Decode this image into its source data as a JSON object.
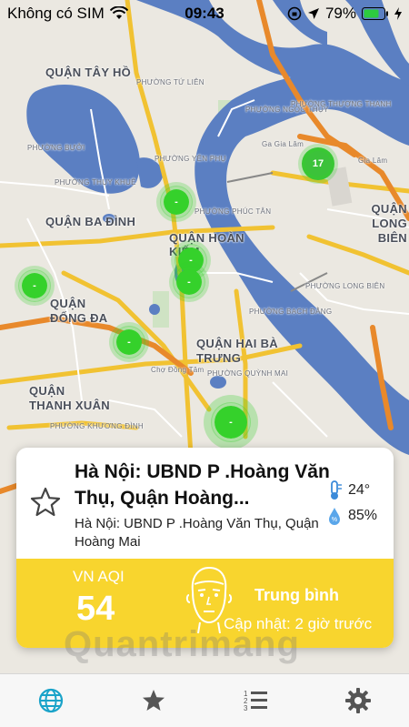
{
  "status_bar": {
    "carrier": "Không có SIM",
    "time": "09:43",
    "battery": "79%"
  },
  "map": {
    "labels": [
      "QUẬN TÂY HỒ",
      "QUẬN BA ĐÌNH",
      "QUẬN HOÀN KIẾM",
      "QUẬN ĐỐNG ĐA",
      "QUẬN HAI BÀ TRƯNG",
      "QUẬN THANH XUÂN",
      "QUẬN LONG BIÊN",
      "PHƯỜNG NGỌC THỤY",
      "PHƯỜNG THƯỢNG THANH",
      "PHƯỜNG TỨ LIÊN",
      "PHƯỜNG YÊN PHỤ",
      "PHƯỜNG BƯỞI",
      "PHƯỜNG THỤY KHUÊ",
      "PHƯỜNG PHÚC TÂN",
      "PHƯỜNG BẠCH ĐẰNG",
      "PHƯỜNG LONG BIÊN",
      "PHƯỜNG QUỲNH MAI",
      "PHƯỜNG KHƯƠNG ĐÌNH",
      "Gia Lâm",
      "Chợ Đồng Tâm",
      "Ga Gia Lâm"
    ],
    "markers": [
      {
        "label": "17",
        "kind": "cluster"
      },
      {
        "label": "-",
        "kind": "station"
      },
      {
        "label": "-",
        "kind": "station"
      },
      {
        "label": "-",
        "kind": "station"
      },
      {
        "label": "-",
        "kind": "station"
      },
      {
        "label": "-",
        "kind": "station"
      },
      {
        "label": "-",
        "kind": "selected"
      }
    ],
    "colors": {
      "water": "#5b7fc2",
      "land": "#ebe8e1",
      "major_road": "#f1c232",
      "highway": "#e8892b",
      "marker": "#35d12b"
    }
  },
  "card": {
    "title": "Hà Nội: UBND P .Hoàng Văn Thụ, Quận Hoàng...",
    "subtitle": "Hà Nội: UBND P .Hoàng Văn Thụ, Quận Hoàng Mai",
    "temperature": "24°",
    "humidity": "85%",
    "aqi_label": "VN AQI",
    "aqi_value": "54",
    "aqi_status": "Trung bình",
    "updated": "Cập nhật: 2 giờ trước",
    "aqi_color": "#f8d52e"
  },
  "tab_bar": {
    "tabs": [
      "globe-icon",
      "star-icon",
      "list-icon",
      "gear-icon"
    ],
    "active_color": "#1aa3c9"
  },
  "watermark": "Quantrimang"
}
